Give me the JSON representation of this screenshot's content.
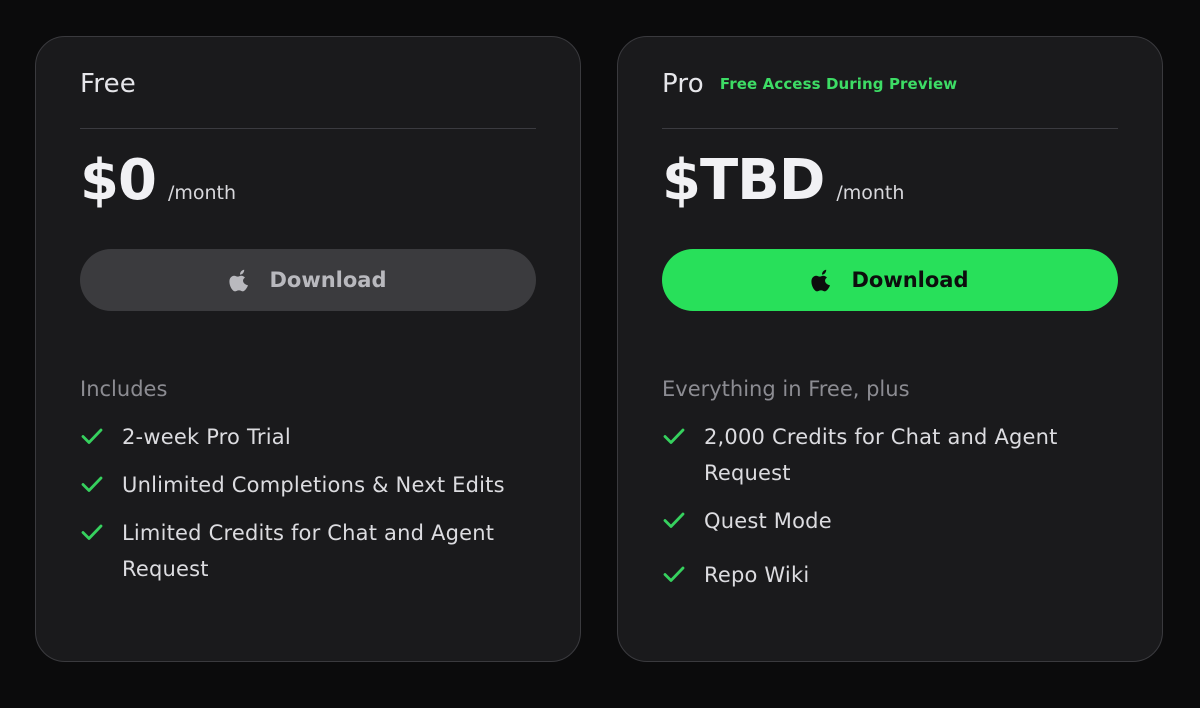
{
  "plans": [
    {
      "name": "Free",
      "badge": "",
      "price": "$0",
      "period": "/month",
      "button": {
        "label": "Download",
        "icon": "apple-icon",
        "style": "gray"
      },
      "includes_title": "Includes",
      "features": [
        "2-week Pro Trial",
        "Unlimited Completions & Next Edits",
        "Limited Credits for Chat and Agent Request"
      ]
    },
    {
      "name": "Pro",
      "badge": "Free Access During Preview",
      "price": "$TBD",
      "period": "/month",
      "button": {
        "label": "Download",
        "icon": "apple-icon",
        "style": "green"
      },
      "includes_title": "Everything in Free, plus",
      "features": [
        "2,000 Credits for Chat and Agent Request",
        "Quest Mode",
        "Repo Wiki"
      ]
    }
  ],
  "colors": {
    "background": "#0b0b0c",
    "card": "#1a1a1c",
    "accent_green": "#28e05a",
    "badge_green": "#3ddc65",
    "check_green": "#36d15e",
    "gray_button": "#3b3b3e"
  }
}
